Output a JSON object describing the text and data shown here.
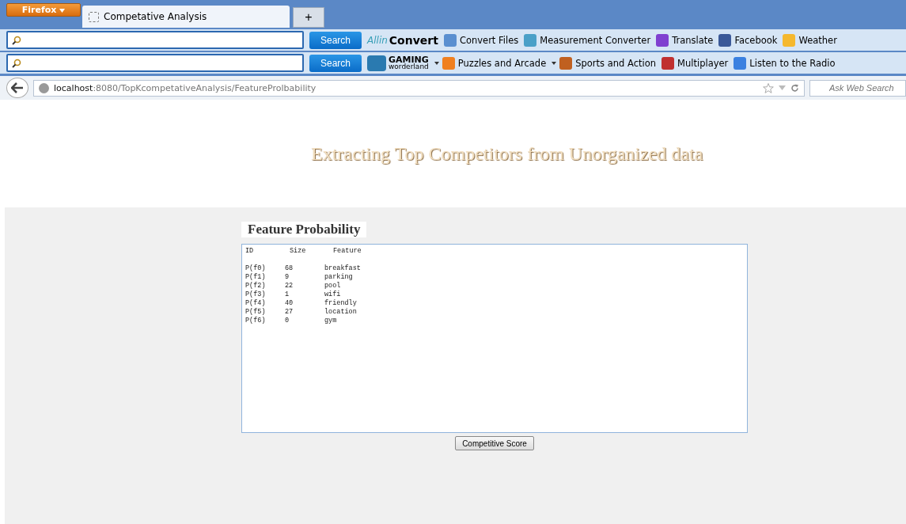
{
  "browser": {
    "menu_button": "Firefox",
    "tabs": [
      {
        "label": "Competative Analysis",
        "selected": true
      }
    ],
    "new_tab": "+",
    "toolbars": [
      {
        "search_button": "Search",
        "logo": "Convert",
        "logo_prefix": "Allin",
        "items": [
          {
            "label": "Convert Files",
            "dropdown": false
          },
          {
            "label": "Measurement Converter",
            "dropdown": false
          },
          {
            "label": "Translate",
            "dropdown": false
          },
          {
            "label": "Facebook",
            "dropdown": false
          },
          {
            "label": "Weather",
            "dropdown": false
          }
        ]
      },
      {
        "search_button": "Search",
        "logo": "GAMING",
        "logo_prefix": "worderland",
        "items": [
          {
            "label": "Puzzles and Arcade",
            "dropdown": true
          },
          {
            "label": "Sports and Action",
            "dropdown": true
          },
          {
            "label": "Multiplayer",
            "dropdown": false
          },
          {
            "label": "Listen to the Radio",
            "dropdown": false
          }
        ]
      }
    ],
    "url_host": "localhost",
    "url_rest": ":8080/TopKcompetativeAnalysis/FeatureProlbability",
    "search_placeholder": "Ask Web Search"
  },
  "page": {
    "title": "Extracting Top Competitors from Unorganized data",
    "section_title": "Feature Probability",
    "output": {
      "columns": [
        "ID",
        "Size",
        "Feature"
      ],
      "rows": [
        [
          "P(f0)",
          "68",
          "breakfast"
        ],
        [
          "P(f1)",
          "9",
          "parking"
        ],
        [
          "P(f2)",
          "22",
          "pool"
        ],
        [
          "P(f3)",
          "1",
          "wifi"
        ],
        [
          "P(f4)",
          "40",
          "friendly"
        ],
        [
          "P(f5)",
          "27",
          "location"
        ],
        [
          "P(f6)",
          "0",
          "gym"
        ]
      ]
    },
    "button": "Competitive Score"
  }
}
